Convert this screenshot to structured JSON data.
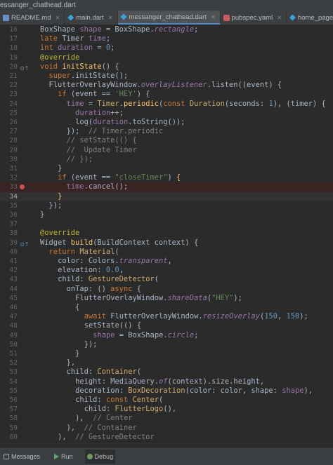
{
  "window": {
    "title": "essanger_chathead.dart"
  },
  "tabs": [
    {
      "label": "README.md",
      "icon": "markdown-file-icon",
      "type": "md"
    },
    {
      "label": "main.dart",
      "icon": "dart-file-icon",
      "type": "dart"
    },
    {
      "label": "messanger_chathead.dart",
      "icon": "dart-file-icon",
      "type": "dart",
      "active": true
    },
    {
      "label": "pubspec.yaml",
      "icon": "yaml-file-icon",
      "type": "yaml"
    },
    {
      "label": "home_page.dart",
      "icon": "dart-file-icon",
      "type": "dart"
    }
  ],
  "editor": {
    "current_line": "34",
    "breakpoint_line": "33",
    "lines": [
      {
        "n": "16",
        "html": "BoxShape <span class='prop'>shape</span> = BoxShape.<span class='it'>rectangle</span>;",
        "indent": 0
      },
      {
        "n": "17",
        "html": "<span class='kw'>late</span> Timer <span class='prop'>time</span>;",
        "indent": 0
      },
      {
        "n": "18",
        "html": "<span class='kw'>int</span> <span class='prop'>duration</span> = <span class='num'>0</span>;",
        "indent": 0
      },
      {
        "n": "19",
        "html": "<span class='an'>@override</span>",
        "indent": 0
      },
      {
        "n": "20",
        "html": "<span class='kw'>void</span> <span class='fn'>initState</span>() {",
        "indent": 0,
        "mark": "override"
      },
      {
        "n": "21",
        "html": "<span class='kw'>super</span>.initState();",
        "indent": 1
      },
      {
        "n": "22",
        "html": "FlutterOverlayWindow.<span class='it'>overlayListener</span>.listen((event) {",
        "indent": 1
      },
      {
        "n": "23",
        "html": "<span class='kw'>if</span> (event == <span class='str'>'HEY'</span>) {",
        "indent": 2
      },
      {
        "n": "24",
        "html": "<span class='prop'>time</span> = <span class='cls'>Timer</span>.<span class='fn'>periodic</span>(<span class='kw'>const</span> <span class='cls'>Duration</span>(seconds: <span class='num'>1</span>), (timer) {",
        "indent": 3
      },
      {
        "n": "25",
        "html": "<span class='prop'>duration</span>++;",
        "indent": 4
      },
      {
        "n": "26",
        "html": "log(<span class='prop'>duration</span>.toString());",
        "indent": 4
      },
      {
        "n": "27",
        "html": "});  <span class='cm'>// Timer.periodic</span>",
        "indent": 3
      },
      {
        "n": "28",
        "html": "<span class='cm'>// setState(() {</span>",
        "indent": 3
      },
      {
        "n": "29",
        "html": "<span class='cm'>//  Update Timer</span>",
        "indent": 3
      },
      {
        "n": "30",
        "html": "<span class='cm'>// });</span>",
        "indent": 3
      },
      {
        "n": "31",
        "html": "}",
        "indent": 2
      },
      {
        "n": "32",
        "html": "<span class='kw'>if</span> (event == <span class='str'>\"closeTimer\"</span>) <span class='fn'>{</span>",
        "indent": 2
      },
      {
        "n": "33",
        "html": "<span class='prop'>time</span>.cancel();",
        "indent": 3,
        "mark": "breakpoint"
      },
      {
        "n": "34",
        "html": "<span class='fn'>}</span>",
        "indent": 2
      },
      {
        "n": "35",
        "html": "});",
        "indent": 1
      },
      {
        "n": "36",
        "html": "}",
        "indent": 0
      },
      {
        "n": "37",
        "html": "",
        "indent": 0
      },
      {
        "n": "38",
        "html": "<span class='an'>@override</span>",
        "indent": 0
      },
      {
        "n": "39",
        "html": "Widget <span class='fn'>build</span>(BuildContext context) {",
        "indent": 0,
        "mark": "override"
      },
      {
        "n": "40",
        "html": "<span class='kw'>return</span> <span class='cls'>Material</span>(",
        "indent": 1
      },
      {
        "n": "41",
        "html": "color: Colors.<span class='it'>transparent</span>,",
        "indent": 2
      },
      {
        "n": "42",
        "html": "elevation: <span class='num'>0.0</span>,",
        "indent": 2
      },
      {
        "n": "43",
        "html": "child: <span class='cls'>GestureDetector</span>(",
        "indent": 2
      },
      {
        "n": "44",
        "html": "onTap: () <span class='kw'>async</span> {",
        "indent": 3
      },
      {
        "n": "45",
        "html": "FlutterOverlayWindow.<span class='it'>shareData</span>(<span class='str'>\"HEY\"</span>);",
        "indent": 4
      },
      {
        "n": "46",
        "html": "{",
        "indent": 4
      },
      {
        "n": "47",
        "html": "<span class='kw'>await</span> FlutterOverlayWindow.<span class='it'>resizeOverlay</span>(<span class='num'>150</span>, <span class='num'>150</span>);",
        "indent": 5
      },
      {
        "n": "48",
        "html": "setState(() {",
        "indent": 5
      },
      {
        "n": "49",
        "html": "<span class='prop'>shape</span> = BoxShape.<span class='it'>circle</span>;",
        "indent": 6
      },
      {
        "n": "50",
        "html": "});",
        "indent": 5
      },
      {
        "n": "51",
        "html": "}",
        "indent": 4
      },
      {
        "n": "52",
        "html": "},",
        "indent": 3
      },
      {
        "n": "53",
        "html": "child: <span class='cls'>Container</span>(",
        "indent": 3
      },
      {
        "n": "54",
        "html": "height: MediaQuery.<span class='it'>of</span>(context).size.height,",
        "indent": 4
      },
      {
        "n": "55",
        "html": "decoration: <span class='cls'>BoxDecoration</span>(color: color, shape: <span class='prop'>shape</span>),",
        "indent": 4
      },
      {
        "n": "56",
        "html": "child: <span class='kw'>const</span> <span class='cls'>Center</span>(",
        "indent": 4
      },
      {
        "n": "57",
        "html": "child: <span class='cls'>FlutterLogo</span>(),",
        "indent": 5
      },
      {
        "n": "58",
        "html": "),  <span class='cm'>// Center</span>",
        "indent": 4
      },
      {
        "n": "59",
        "html": "),  <span class='cm'>// Container</span>",
        "indent": 3
      },
      {
        "n": "60",
        "html": "),  <span class='cm'>// GestureDetector</span>",
        "indent": 2
      }
    ]
  },
  "bottom_bar": {
    "tabs": [
      {
        "label": "Messages",
        "icon": "messages-icon",
        "type": "msg"
      },
      {
        "label": "Run",
        "icon": "run-icon",
        "type": "run"
      },
      {
        "label": "Debug",
        "icon": "debug-icon",
        "type": "dbg",
        "active": true
      }
    ]
  }
}
